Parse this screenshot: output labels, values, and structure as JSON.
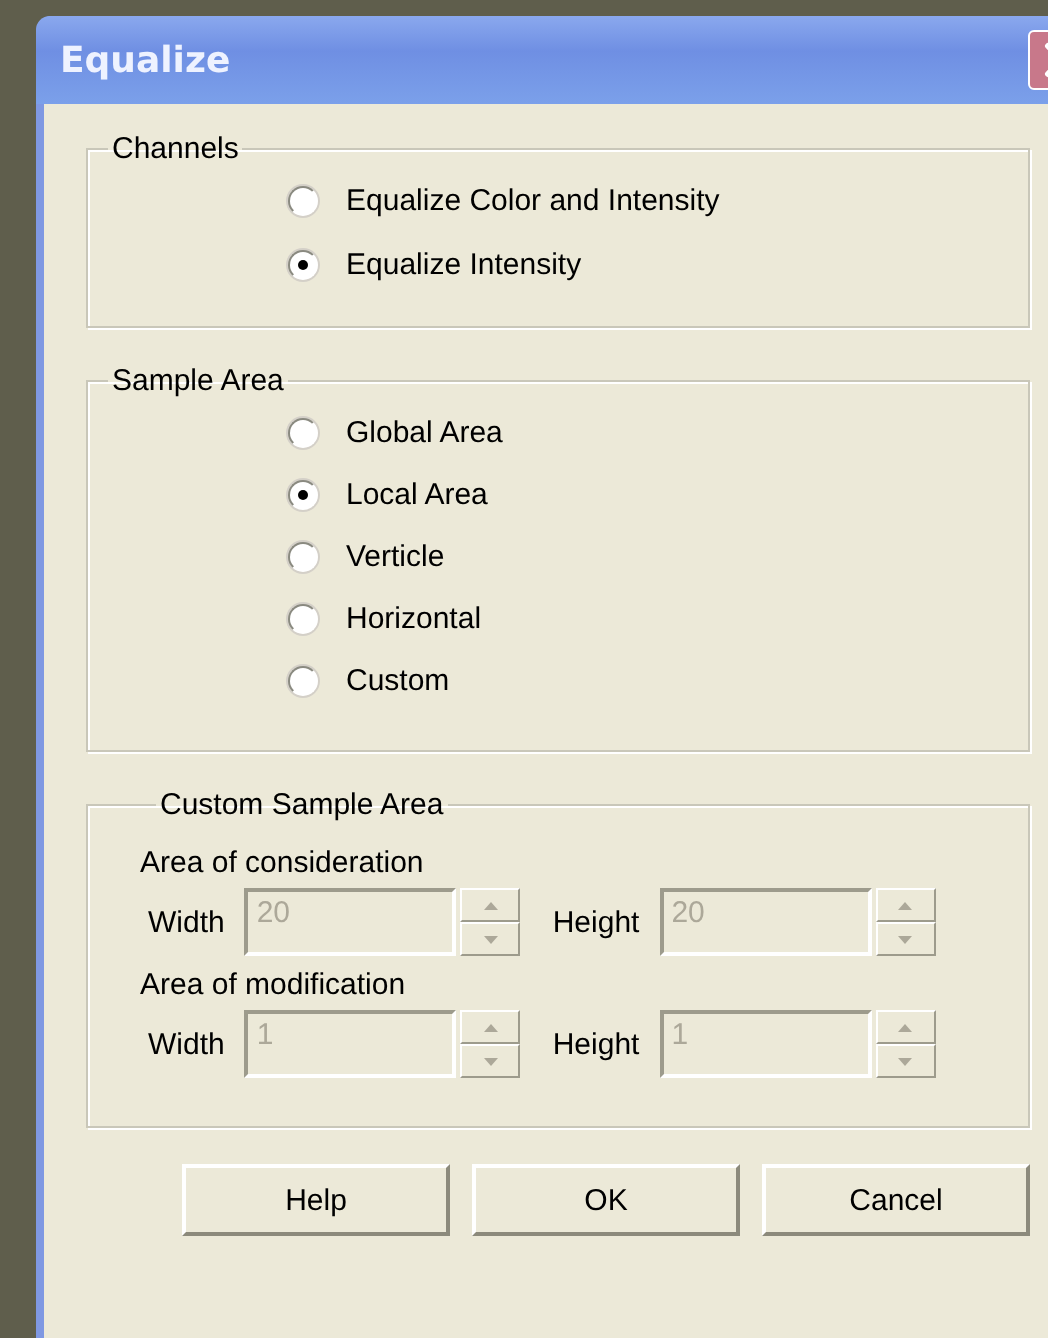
{
  "window": {
    "title": "Equalize"
  },
  "groups": [
    {
      "title": "Channels",
      "options": [
        {
          "label": "Equalize Color and Intensity",
          "selected": false
        },
        {
          "label": "Equalize Intensity",
          "selected": true
        }
      ]
    },
    {
      "title": "Sample Area",
      "options": [
        {
          "label": "Global Area",
          "selected": false
        },
        {
          "label": "Local Area",
          "selected": true
        },
        {
          "label": "Verticle",
          "selected": false
        },
        {
          "label": "Horizontal",
          "selected": false
        },
        {
          "label": "Custom",
          "selected": false
        }
      ]
    }
  ],
  "custom_sample_area": {
    "title": "Custom Sample Area",
    "sections": [
      {
        "label": "Area of consideration",
        "fields": [
          {
            "label": "Width",
            "value": "20",
            "disabled": true
          },
          {
            "label": "Height",
            "value": "20",
            "disabled": true
          }
        ]
      },
      {
        "label": "Area of modification",
        "fields": [
          {
            "label": "Width",
            "value": "1",
            "disabled": true
          },
          {
            "label": "Height",
            "value": "1",
            "disabled": true
          }
        ]
      }
    ]
  },
  "buttons": [
    "Help",
    "OK",
    "Cancel"
  ]
}
